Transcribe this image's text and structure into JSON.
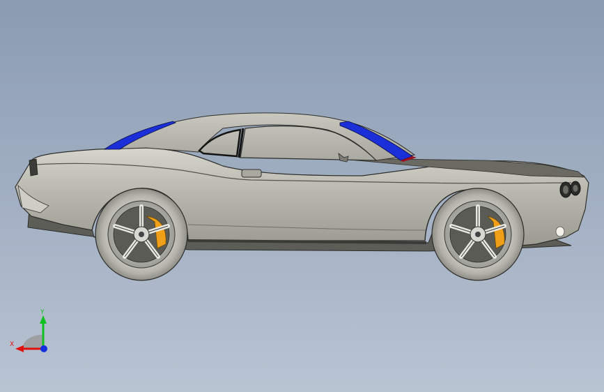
{
  "triad": {
    "x_label": "X",
    "y_label": "Y",
    "x_color": "#e01010",
    "y_color": "#10c020",
    "z_color": "#1030e0"
  },
  "model": {
    "body_color": "#b8b7ad",
    "glass_color": "#1a2fd8",
    "caliper_color": "#f0a018",
    "background_top": "#8a9bb2",
    "background_bottom": "#b9c4d3"
  }
}
